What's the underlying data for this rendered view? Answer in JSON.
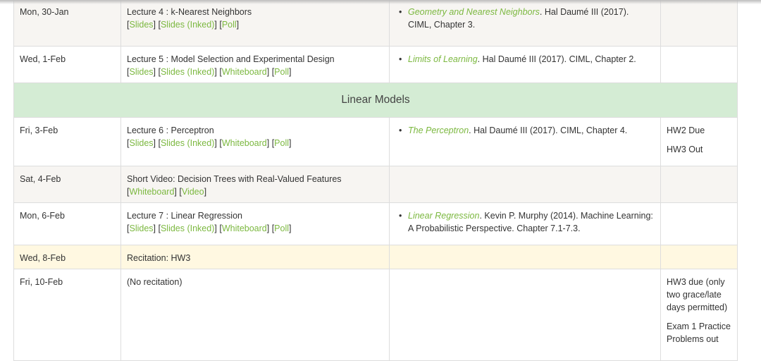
{
  "rows": {
    "r1": {
      "date": "Mon, 30-Jan",
      "title": "Lecture 4 : k-Nearest Neighbors",
      "links": [
        "Slides",
        "Slides (Inked)",
        "Poll"
      ],
      "reading_link": "Geometry and Nearest Neighbors",
      "reading_rest": ". Hal Daumé III (2017). CIML, Chapter 3."
    },
    "r2": {
      "date": "Wed, 1-Feb",
      "title": "Lecture 5 : Model Selection and Experimental Design",
      "links": [
        "Slides",
        "Slides (Inked)",
        "Whiteboard",
        "Poll"
      ],
      "reading_link": "Limits of Learning",
      "reading_rest": ". Hal Daumé III (2017). CIML, Chapter 2."
    },
    "section": "Linear Models",
    "r3": {
      "date": "Fri, 3-Feb",
      "title": "Lecture 6 : Perceptron",
      "links": [
        "Slides",
        "Slides (Inked)",
        "Whiteboard",
        "Poll"
      ],
      "reading_link": "The Perceptron",
      "reading_rest": ". Hal Daumé III (2017). CIML, Chapter 4.",
      "notes": [
        "HW2 Due",
        "HW3 Out"
      ]
    },
    "r4": {
      "date": "Sat, 4-Feb",
      "title": "Short Video: Decision Trees with Real-Valued Features",
      "links": [
        "Whiteboard",
        "Video"
      ]
    },
    "r5": {
      "date": "Mon, 6-Feb",
      "title": "Lecture 7 : Linear Regression",
      "links": [
        "Slides",
        "Slides (Inked)",
        "Whiteboard",
        "Poll"
      ],
      "reading_link": "Linear Regression",
      "reading_rest": ". Kevin P. Murphy (2014). Machine Learning: A Probabilistic Perspective. Chapter 7.1-7.3."
    },
    "r6": {
      "date": "Wed, 8-Feb",
      "title": "Recitation: HW3"
    },
    "r7": {
      "date": "Fri, 10-Feb",
      "title": "(No recitation)",
      "notes": [
        "HW3 due (only two grace/late days permitted)",
        "Exam 1 Practice Problems out"
      ]
    }
  },
  "colors": {
    "link": "#7cb840",
    "section_bg": "#d4ecd4",
    "shaded_bg": "#f7f5f2",
    "recitation_bg": "#fff8e1"
  }
}
